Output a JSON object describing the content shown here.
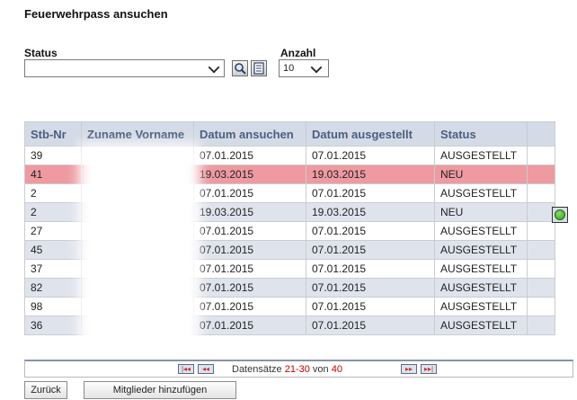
{
  "page": {
    "title": "Feuerwehrpass ansuchen"
  },
  "filters": {
    "status_label": "Status",
    "status_value": "",
    "anzahl_label": "Anzahl",
    "anzahl_value": "10",
    "search_icon": "magnifier-icon",
    "list_icon": "list-icon"
  },
  "table": {
    "columns": [
      "Stb-Nr",
      "Zuname Vorname",
      "Datum ansuchen",
      "Datum ausgestellt",
      "Status",
      ""
    ],
    "rows": [
      {
        "stb": "39",
        "name": "",
        "ansuchen": "07.01.2015",
        "ausgestellt": "07.01.2015",
        "status": "AUSGESTELLT"
      },
      {
        "stb": "41",
        "name": "",
        "ansuchen": "19.03.2015",
        "ausgestellt": "19.03.2015",
        "status": "NEU"
      },
      {
        "stb": "2",
        "name": "",
        "ansuchen": "07.01.2015",
        "ausgestellt": "07.01.2015",
        "status": "AUSGESTELLT"
      },
      {
        "stb": "2",
        "name": "",
        "ansuchen": "19.03.2015",
        "ausgestellt": "19.03.2015",
        "status": "NEU"
      },
      {
        "stb": "27",
        "name": "",
        "ansuchen": "07.01.2015",
        "ausgestellt": "07.01.2015",
        "status": "AUSGESTELLT"
      },
      {
        "stb": "45",
        "name": "",
        "ansuchen": "07.01.2015",
        "ausgestellt": "07.01.2015",
        "status": "AUSGESTELLT"
      },
      {
        "stb": "37",
        "name": "",
        "ansuchen": "07.01.2015",
        "ausgestellt": "07.01.2015",
        "status": "AUSGESTELLT"
      },
      {
        "stb": "82",
        "name": "",
        "ansuchen": "07.01.2015",
        "ausgestellt": "07.01.2015",
        "status": "AUSGESTELLT"
      },
      {
        "stb": "98",
        "name": "",
        "ansuchen": "07.01.2015",
        "ausgestellt": "07.01.2015",
        "status": "AUSGESTELLT"
      },
      {
        "stb": "36",
        "name": "",
        "ansuchen": "07.01.2015",
        "ausgestellt": "07.01.2015",
        "status": "AUSGESTELLT"
      }
    ]
  },
  "pager": {
    "prefix": "Datensätze ",
    "range": "21-30",
    "middle": " von ",
    "total": "40",
    "first": "|◂◂",
    "prev": "◂◂",
    "next": "▸▸",
    "last": "▸▸|"
  },
  "buttons": {
    "back": "Zurück",
    "add_members": "Mitglieder hinzufügen"
  },
  "colors": {
    "header_bg": "#d5dbe6",
    "header_text": "#4a5f80",
    "row_alt": "#dfe4ec",
    "row_new_highlight": "#ee9aa0",
    "accent_red": "#c00000"
  }
}
